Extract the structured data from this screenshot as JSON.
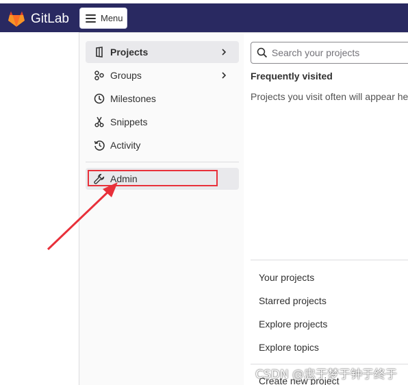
{
  "header": {
    "brand_name": "GitLab",
    "menu_label": "Menu",
    "colors": {
      "topbar": "#292961",
      "logo_orange": "#e24329",
      "logo_light": "#fca326"
    }
  },
  "sidebar": {
    "items": [
      {
        "label": "Projects",
        "icon": "project-icon",
        "active": true,
        "has_submenu": true
      },
      {
        "label": "Groups",
        "icon": "group-icon",
        "active": false,
        "has_submenu": true
      },
      {
        "label": "Milestones",
        "icon": "clock-icon",
        "active": false,
        "has_submenu": false
      },
      {
        "label": "Snippets",
        "icon": "scissors-icon",
        "active": false,
        "has_submenu": false
      },
      {
        "label": "Activity",
        "icon": "history-icon",
        "active": false,
        "has_submenu": false
      }
    ],
    "admin": {
      "label": "Admin",
      "icon": "wrench-icon"
    }
  },
  "projects_panel": {
    "search_placeholder": "Search your projects",
    "frequent_title": "Frequently visited",
    "frequent_empty": "Projects you visit often will appear here",
    "links": [
      "Your projects",
      "Starred projects",
      "Explore projects",
      "Explore topics",
      "Create new project"
    ]
  },
  "annotation": {
    "color": "#e8303a"
  },
  "watermark": "CSDN @忠于梦于钟于终于"
}
